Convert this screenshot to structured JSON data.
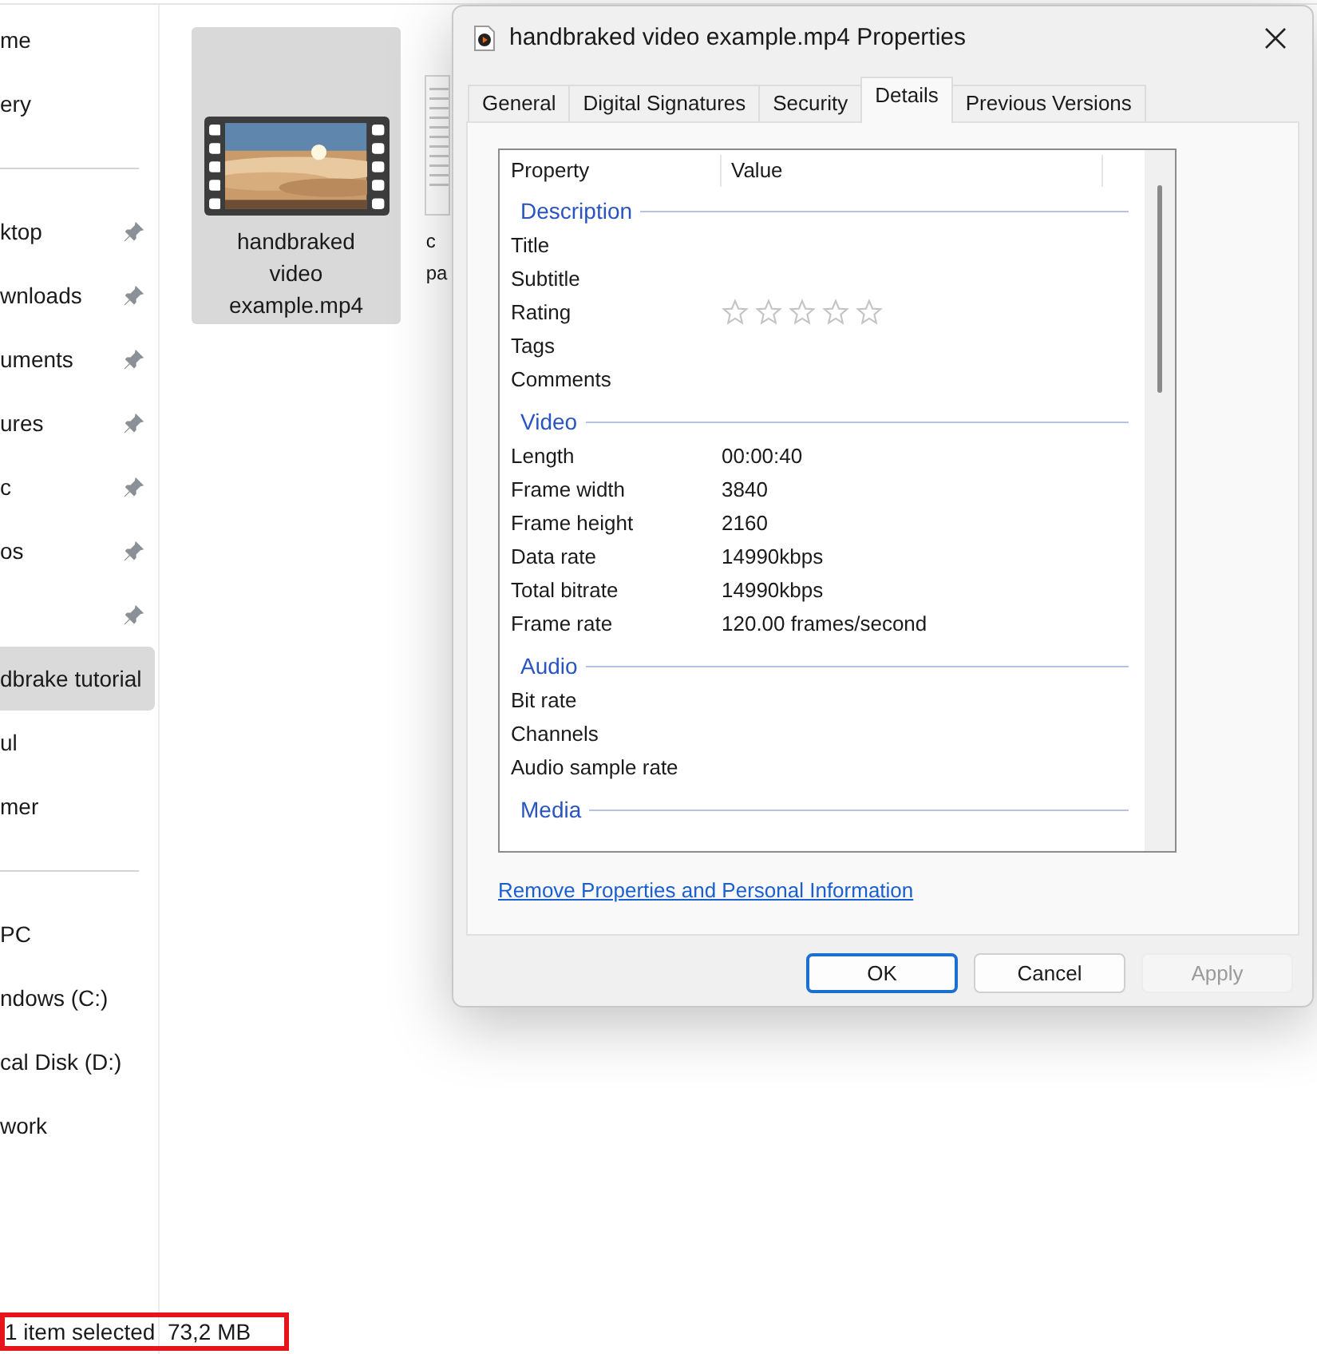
{
  "sidebar": {
    "items": [
      {
        "label": "me",
        "pinned": false,
        "selected": false
      },
      {
        "label": "ery",
        "pinned": false,
        "selected": false
      },
      {
        "kind": "divider"
      },
      {
        "label": "ktop",
        "pinned": true,
        "selected": false
      },
      {
        "label": "wnloads",
        "pinned": true,
        "selected": false
      },
      {
        "label": "uments",
        "pinned": true,
        "selected": false
      },
      {
        "label": "ures",
        "pinned": true,
        "selected": false
      },
      {
        "label": "c",
        "pinned": true,
        "selected": false
      },
      {
        "label": "os",
        "pinned": true,
        "selected": false
      },
      {
        "pinned": true,
        "selected": false
      },
      {
        "label": "dbrake tutorial",
        "pinned": false,
        "selected": true
      },
      {
        "label": "ul",
        "pinned": false,
        "selected": false
      },
      {
        "label": "mer",
        "pinned": false,
        "selected": false
      },
      {
        "kind": "divider"
      },
      {
        "label": "PC",
        "pinned": false,
        "selected": false
      },
      {
        "label": "ndows (C:)",
        "pinned": false,
        "selected": false
      },
      {
        "label": "cal Disk (D:)",
        "pinned": false,
        "selected": false
      },
      {
        "label": "work",
        "pinned": false,
        "selected": false
      }
    ]
  },
  "files": [
    {
      "kind": "video",
      "label_lines": [
        "handbraked",
        "video",
        "example.mp4"
      ],
      "selected": true
    },
    {
      "kind": "document",
      "label_lines": [
        "c",
        "pa"
      ],
      "selected": false
    }
  ],
  "status_bar": {
    "text": "1 item selected  73,2 MB",
    "highlighted": true
  },
  "dialog": {
    "title": "handbraked video example.mp4 Properties",
    "tabs": [
      {
        "label": "General",
        "selected": false
      },
      {
        "label": "Digital Signatures",
        "selected": false
      },
      {
        "label": "Security",
        "selected": false
      },
      {
        "label": "Details",
        "selected": true
      },
      {
        "label": "Previous Versions",
        "selected": false
      }
    ],
    "columns": [
      "Property",
      "Value"
    ],
    "sections": [
      {
        "title": "Description",
        "rows": [
          {
            "property": "Title"
          },
          {
            "property": "Subtitle"
          },
          {
            "property": "Rating",
            "kind": "stars",
            "stars": 0
          },
          {
            "property": "Tags"
          },
          {
            "property": "Comments"
          }
        ]
      },
      {
        "title": "Video",
        "rows": [
          {
            "property": "Length",
            "value": "00:00:40"
          },
          {
            "property": "Frame width",
            "value": "3840"
          },
          {
            "property": "Frame height",
            "value": "2160"
          },
          {
            "property": "Data rate",
            "value": "14990kbps"
          },
          {
            "property": "Total bitrate",
            "value": "14990kbps"
          },
          {
            "property": "Frame rate",
            "value": "120.00 frames/second"
          }
        ]
      },
      {
        "title": "Audio",
        "rows": [
          {
            "property": "Bit rate"
          },
          {
            "property": "Channels"
          },
          {
            "property": "Audio sample rate"
          }
        ]
      },
      {
        "title": "Media"
      }
    ],
    "link": "Remove Properties and Personal Information",
    "buttons": [
      {
        "label": "OK",
        "default": true,
        "disabled": false
      },
      {
        "label": "Cancel",
        "default": false,
        "disabled": false
      },
      {
        "label": "Apply",
        "default": false,
        "disabled": true
      }
    ]
  }
}
